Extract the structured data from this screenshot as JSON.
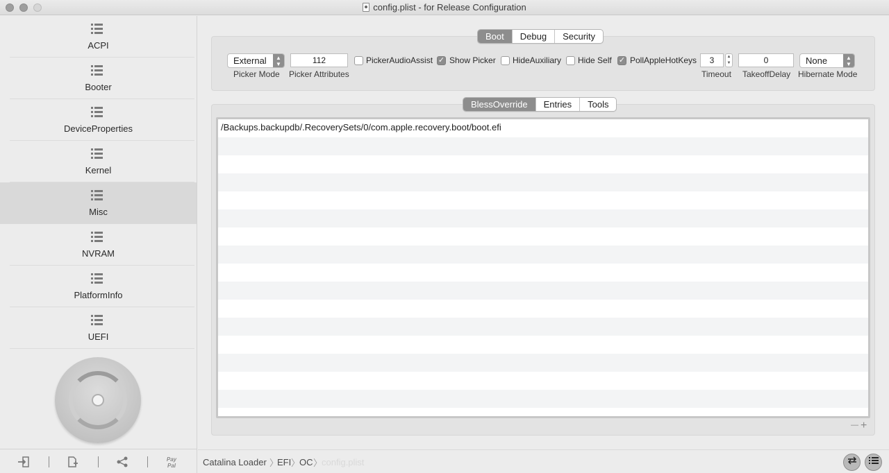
{
  "window": {
    "title": "config.plist - for Release Configuration"
  },
  "sidebar": {
    "items": [
      {
        "label": "ACPI",
        "icon": "list-icon",
        "active": false
      },
      {
        "label": "Booter",
        "icon": "list-icon",
        "active": false
      },
      {
        "label": "DeviceProperties",
        "icon": "list-icon",
        "active": false
      },
      {
        "label": "Kernel",
        "icon": "list-icon",
        "active": false
      },
      {
        "label": "Misc",
        "icon": "list-icon",
        "active": true
      },
      {
        "label": "NVRAM",
        "icon": "list-icon",
        "active": false
      },
      {
        "label": "PlatformInfo",
        "icon": "list-icon",
        "active": false
      },
      {
        "label": "UEFI",
        "icon": "list-icon",
        "active": false
      }
    ],
    "logo": "disc-logo",
    "bottom_buttons": [
      {
        "icon": "import-icon"
      },
      {
        "icon": "add-file-icon"
      },
      {
        "icon": "share-icon"
      },
      {
        "icon": "paypal-icon",
        "label_line1": "Pay",
        "label_line2": "Pal"
      }
    ]
  },
  "top_tabs": {
    "items": [
      "Boot",
      "Debug",
      "Security"
    ],
    "selected": "Boot"
  },
  "boot": {
    "picker_mode": {
      "value": "External",
      "caption": "Picker Mode"
    },
    "picker_attributes": {
      "value": "112",
      "caption": "Picker Attributes"
    },
    "checkboxes": [
      {
        "label": "PickerAudioAssist",
        "checked": false
      },
      {
        "label": "Show Picker",
        "checked": true
      },
      {
        "label": "HideAuxiliary",
        "checked": false
      },
      {
        "label": "Hide Self",
        "checked": false
      },
      {
        "label": "PollAppleHotKeys",
        "checked": true
      }
    ],
    "timeout": {
      "value": "3",
      "caption": "Timeout"
    },
    "takeoff_delay": {
      "value": "0",
      "caption": "TakeoffDelay"
    },
    "hibernate_mode": {
      "value": "None",
      "caption": "Hibernate Mode"
    }
  },
  "sub_tabs": {
    "items": [
      "BlessOverride",
      "Entries",
      "Tools"
    ],
    "selected": "BlessOverride"
  },
  "table": {
    "rows": [
      "/Backups.backupdb/.RecoverySets/0/com.apple.recovery.boot/boot.efi"
    ]
  },
  "table_controls": {
    "remove": "—",
    "add": "+"
  },
  "breadcrumb": [
    "Catalina Loader",
    "EFI",
    "OC",
    "config.plist"
  ],
  "bottom_right_buttons": [
    {
      "icon": "sync-icon"
    },
    {
      "icon": "list-view-icon"
    }
  ]
}
